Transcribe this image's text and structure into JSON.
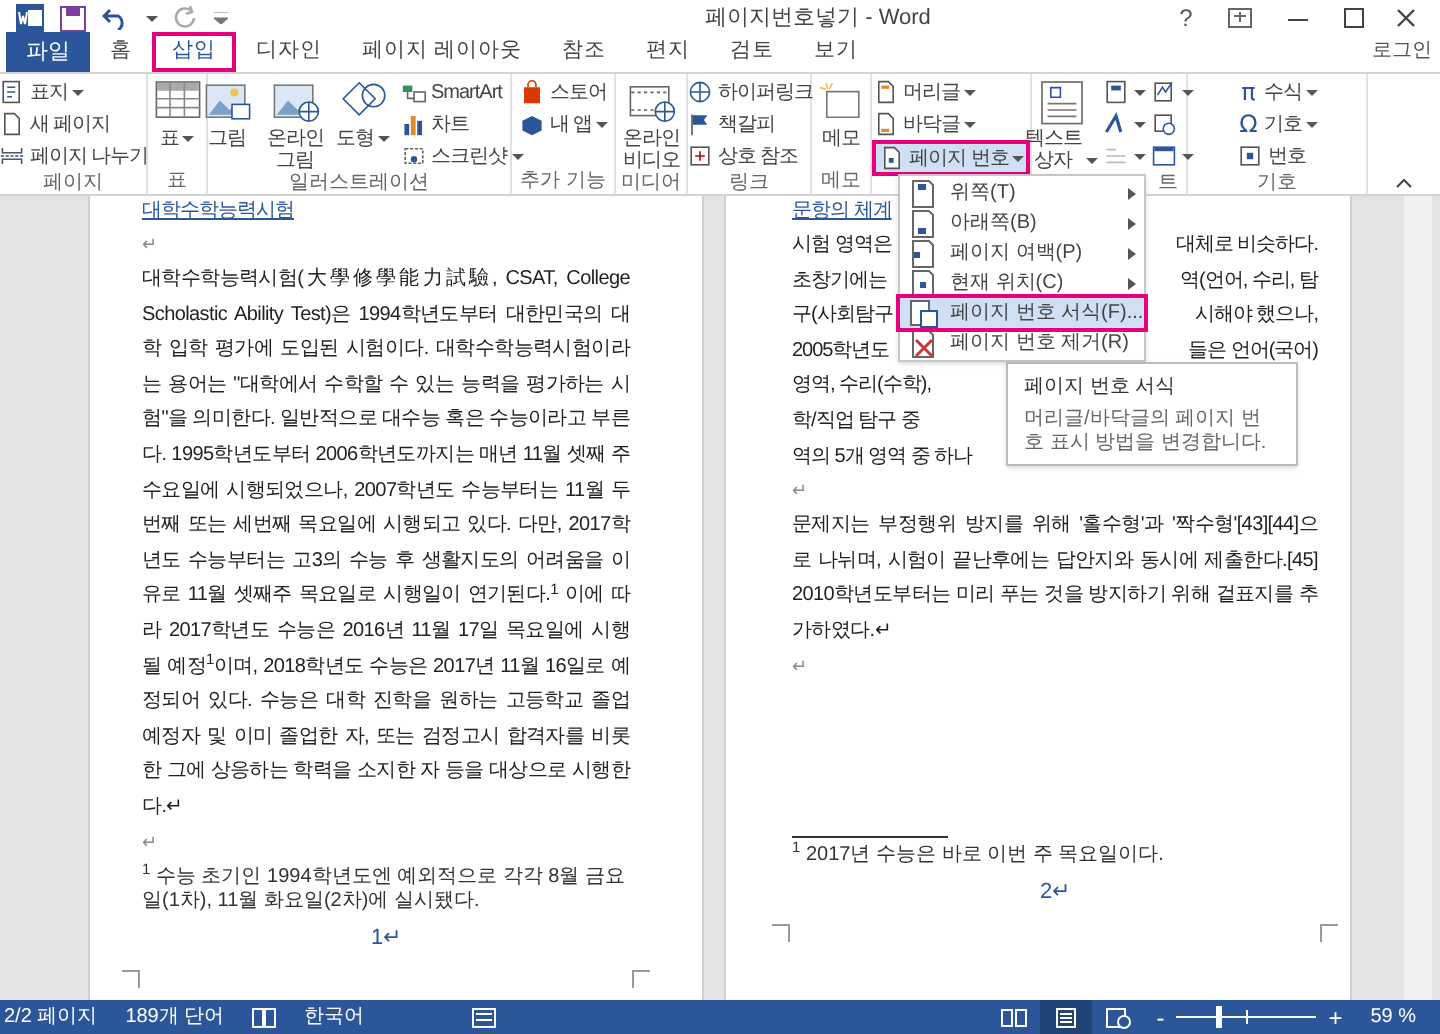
{
  "window": {
    "title": "페이지번호넣기 - Word",
    "help": "?"
  },
  "tabs": [
    {
      "label": "파일",
      "kind": "file",
      "selected": false
    },
    {
      "label": "홈",
      "kind": "tab",
      "selected": false
    },
    {
      "label": "삽입",
      "kind": "tab",
      "selected": true
    },
    {
      "label": "디자인",
      "kind": "tab",
      "selected": false
    },
    {
      "label": "페이지 레이아웃",
      "kind": "tab",
      "selected": false
    },
    {
      "label": "참조",
      "kind": "tab",
      "selected": false
    },
    {
      "label": "편지",
      "kind": "tab",
      "selected": false
    },
    {
      "label": "검토",
      "kind": "tab",
      "selected": false
    },
    {
      "label": "보기",
      "kind": "tab",
      "selected": false
    }
  ],
  "account": "로그인",
  "ribbon": {
    "groups": [
      {
        "label": "페이지",
        "columns": [
          [
            {
              "kind": "small",
              "label": "표지",
              "dropdown": true
            },
            {
              "kind": "small",
              "label": "새 페이지",
              "dropdown": false
            },
            {
              "kind": "small",
              "label": "페이지 나누기",
              "dropdown": false
            }
          ]
        ]
      },
      {
        "label": "표",
        "columns": [
          [
            {
              "kind": "big",
              "label": "표",
              "dropdown": true
            }
          ]
        ]
      },
      {
        "label": "일러스트레이션",
        "columns": [
          [
            {
              "kind": "big",
              "label": "그림",
              "dropdown": false
            }
          ],
          [
            {
              "kind": "big",
              "label": "온라인\n그림",
              "dropdown": false
            }
          ],
          [
            {
              "kind": "big",
              "label": "도형",
              "dropdown": true
            }
          ],
          [
            {
              "kind": "small",
              "label": "SmartArt",
              "dropdown": false
            },
            {
              "kind": "small",
              "label": "차트",
              "dropdown": false
            },
            {
              "kind": "small",
              "label": "스크린샷",
              "dropdown": true
            }
          ]
        ]
      },
      {
        "label": "추가 기능",
        "columns": [
          [
            {
              "kind": "small",
              "label": "스토어",
              "dropdown": false
            },
            {
              "kind": "small",
              "label": "내 앱",
              "dropdown": true
            }
          ]
        ]
      },
      {
        "label": "미디어",
        "columns": [
          [
            {
              "kind": "big",
              "label": "온라인\n비디오",
              "dropdown": false
            }
          ]
        ]
      },
      {
        "label": "링크",
        "columns": [
          [
            {
              "kind": "small",
              "label": "하이퍼링크",
              "dropdown": false
            },
            {
              "kind": "small",
              "label": "책갈피",
              "dropdown": false
            },
            {
              "kind": "small",
              "label": "상호 참조",
              "dropdown": false
            }
          ]
        ]
      },
      {
        "label": "메모",
        "columns": [
          [
            {
              "kind": "big",
              "label": "메모",
              "dropdown": false
            }
          ]
        ]
      },
      {
        "columns": [
          [
            {
              "kind": "small",
              "label": "머리글",
              "dropdown": true,
              "selected": false
            },
            {
              "kind": "small",
              "label": "바닥글",
              "dropdown": true,
              "selected": false
            },
            {
              "kind": "small",
              "label": "페이지 번호",
              "dropdown": true,
              "selected": true
            }
          ]
        ]
      },
      {
        "label": "트",
        "columns": [
          [
            {
              "kind": "big",
              "label": "텍스트\n상자",
              "dropdown": true
            }
          ],
          [
            {
              "kind": "icon",
              "dropdown": true
            },
            {
              "kind": "icon",
              "dropdown": true
            },
            {
              "kind": "icon",
              "dropdown": true
            }
          ],
          [
            {
              "kind": "icon",
              "dropdown": true
            },
            {
              "kind": "icon",
              "dropdown": false
            },
            {
              "kind": "icon",
              "dropdown": true
            }
          ]
        ]
      },
      {
        "label": "기호",
        "columns": [
          [
            {
              "kind": "small",
              "label": "수식",
              "glyph": "π",
              "dropdown": true
            },
            {
              "kind": "small",
              "label": "기호",
              "glyph": "Ω",
              "dropdown": true
            },
            {
              "kind": "small",
              "label": "번호",
              "dropdown": false
            }
          ]
        ]
      }
    ]
  },
  "menu": {
    "items": [
      {
        "label": "위쪽(T)",
        "submenu": true,
        "selected": false
      },
      {
        "label": "아래쪽(B)",
        "submenu": true,
        "selected": false
      },
      {
        "label": "페이지 여백(P)",
        "submenu": true,
        "selected": false
      },
      {
        "label": "현재 위치(C)",
        "submenu": true,
        "selected": false
      },
      {
        "label": "페이지 번호 서식(F)...",
        "submenu": false,
        "selected": true
      },
      {
        "label": "페이지 번호 제거(R)",
        "submenu": false,
        "selected": false
      }
    ]
  },
  "tooltip": {
    "title": "페이지 번호 서식",
    "text": "머리글/바닥글의 페이지 번호 표시 방법을 변경합니다."
  },
  "pages": [
    {
      "heading": "대학수학능력시험",
      "blocks": [
        {
          "kind": "mark",
          "text": "↵"
        },
        {
          "kind": "paragraph",
          "text": "대학수학능력시험(大學修學能力試驗, CSAT, College Scholastic Ability Test)은 1994학년도부터 대한민국의 대학 입학 평가에 도입된 시험이다. 대학수학능력시험이라는 용어는 \"대학에서 수학할 수 있는 능력을 평가하는 시험\"을 의미한다. 일반적으로 대수능 혹은 수능이라고 부른다. 1995학년도부터 2006학년도까지는 매년 11월 셋째 주 수요일에 시행되었으나, 2007학년도 수능부터는 11월 두번째 또는 세번째 목요일에 시행되고 있다. 다만, 2017학년도 수능부터는 고3의 수능 후 생활지도의 어려움을 이유로 11월 셋째주 목요일로 시행일이 연기된다.$^{1}$ 이에 따라 2017학년도 수능은 2016년 11월 17일 목요일에 시행될 예정$^{1}$이며, 2018학년도 수능은 2017년 11월 16일로 예정되어 있다. 수능은 대학 진학을 원하는 고등학교 졸업 예정자 및 이미 졸업한 자, 또는 검정고시 합격자를 비롯한 그에 상응하는 학력을 소지한 자 등을 대상으로 시행한다.↵"
        },
        {
          "kind": "mark",
          "text": "↵"
        }
      ],
      "footnote": "$^{1}$ 수능 초기인 1994학년도엔 예외적으로 각각 8월 금요일(1차), 11월 화요일(2차)에 실시됐다.",
      "page_number": "1↵"
    },
    {
      "heading": "문항의 체계",
      "blocks": [
        {
          "kind": "split",
          "left": "시험 영역은",
          "right": "대체로 비슷하다."
        },
        {
          "kind": "split",
          "left": "초창기에는",
          "right": "역(언어, 수리, 탐"
        },
        {
          "kind": "split",
          "left": "구(사회탐구",
          "right": "시해야 했으나,"
        },
        {
          "kind": "split",
          "left": "2005학년도",
          "right": "들은 언어(국어)"
        },
        {
          "kind": "split",
          "left": "영역, 수리(수학),"
        },
        {
          "kind": "split",
          "left": "학/직업 탐구 중"
        },
        {
          "kind": "split",
          "left": "역의 5개 영역 중 하나"
        },
        {
          "kind": "mark",
          "text": "↵"
        },
        {
          "kind": "paragraph",
          "text": "문제지는 부정행위 방지를 위해 '홀수형'과 '짝수형'[43][44]으로 나뉘며, 시험이 끝난후에는 답안지와 동시에 제출한다.[45] 2010학년도부터는 미리 푸는 것을 방지하기 위해 겉표지를 추가하였다.↵"
        },
        {
          "kind": "mark",
          "text": "↵"
        }
      ],
      "footnote": "$^{1}$ 2017년 수능은 바로 이번 주 목요일이다.",
      "page_number": "2↵"
    }
  ],
  "status_bar": {
    "page": "2/2 페이지",
    "words": "189개 단어",
    "language": "한국어",
    "views": [
      {
        "selected": false
      },
      {
        "selected": true
      },
      {
        "selected": false
      }
    ],
    "zoom": {
      "minus": "-",
      "plus": "+",
      "level": 0.3,
      "reading": "59 %"
    }
  }
}
